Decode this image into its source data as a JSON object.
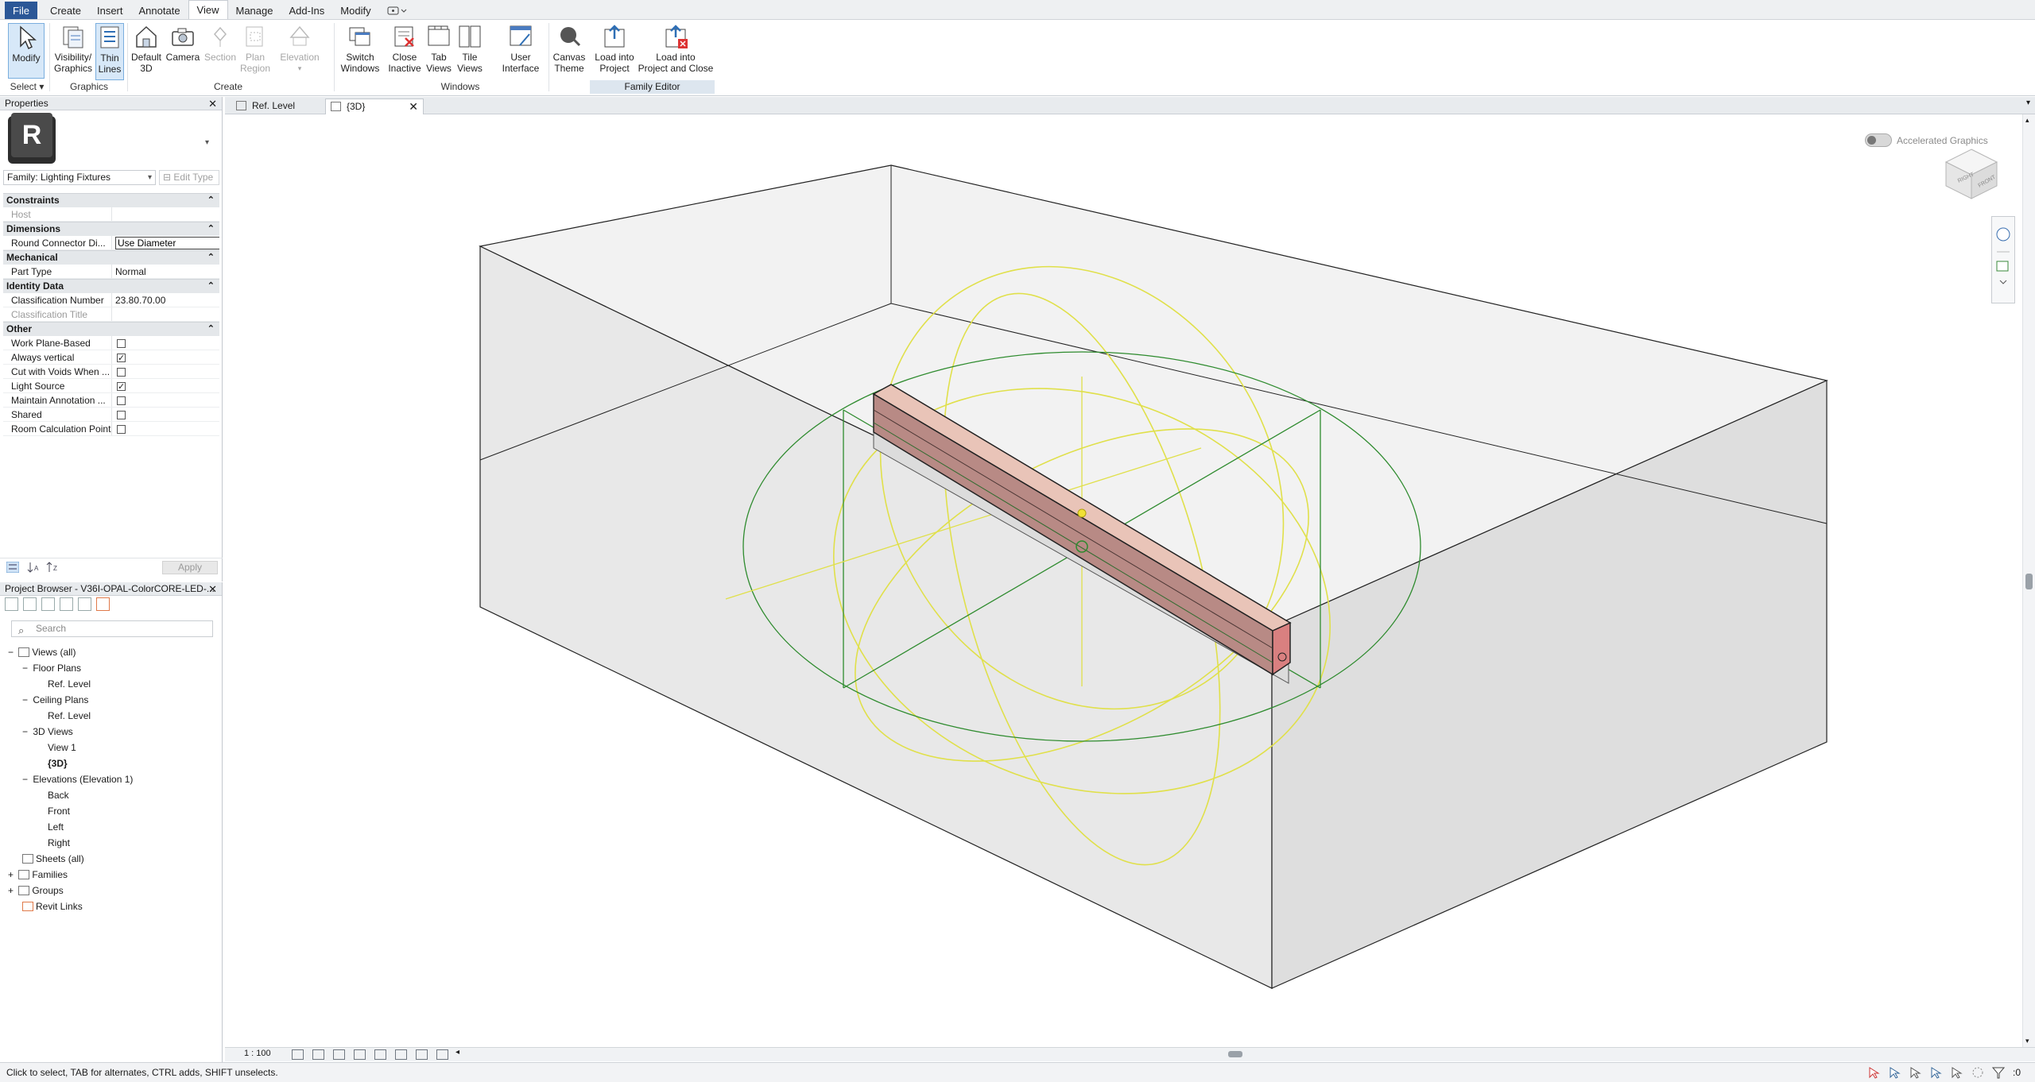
{
  "ribbon_tabs": [
    "File",
    "Create",
    "Insert",
    "Annotate",
    "View",
    "Manage",
    "Add-Ins",
    "Modify"
  ],
  "active_tab": "View",
  "ribbon": {
    "modify": "Modify",
    "select": "Select",
    "visibility_1": "Visibility/",
    "visibility_2": "Graphics",
    "thin_1": "Thin",
    "thin_2": "Lines",
    "graphics_group": "Graphics",
    "default3d_1": "Default",
    "default3d_2": "3D",
    "camera": "Camera",
    "section": "Section",
    "plan_region_1": "Plan",
    "plan_region_2": "Region",
    "elevation": "Elevation",
    "create_group": "Create",
    "switch_1": "Switch",
    "switch_2": "Windows",
    "close_1": "Close",
    "close_2": "Inactive",
    "tab_1": "Tab",
    "tab_2": "Views",
    "tile_1": "Tile",
    "tile_2": "Views",
    "ui_1": "User",
    "ui_2": "Interface",
    "windows_group": "Windows",
    "canvas_1": "Canvas",
    "canvas_2": "Theme",
    "load_1": "Load into",
    "load_2": "Project",
    "loadclose_1": "Load into",
    "loadclose_2": "Project and Close",
    "family_editor_group": "Family Editor"
  },
  "properties": {
    "title": "Properties",
    "family_selector": "Family: Lighting Fixtures",
    "edit_type": "Edit Type",
    "apply": "Apply",
    "sections": {
      "constraints": "Constraints",
      "dimensions": "Dimensions",
      "mechanical": "Mechanical",
      "identity": "Identity Data",
      "other": "Other"
    },
    "host": "Host",
    "round_connector": "Round Connector Di...",
    "round_connector_value": "Use Diameter",
    "part_type": "Part Type",
    "part_type_value": "Normal",
    "class_number": "Classification Number",
    "class_number_value": "23.80.70.00",
    "class_title": "Classification Title",
    "work_plane": "Work Plane-Based",
    "always_vertical": "Always vertical",
    "cut_voids": "Cut with Voids When ...",
    "light_source": "Light Source",
    "maintain_annotation": "Maintain Annotation ...",
    "shared": "Shared",
    "room_calc": "Room Calculation Point",
    "checks": {
      "work_plane": false,
      "always_vertical": true,
      "cut_voids": false,
      "light_source": true,
      "maintain_annotation": false,
      "shared": false,
      "room_calc": false
    }
  },
  "browser": {
    "title": "Project Browser - V36I-OPAL-ColorCORE-LED-...",
    "search_placeholder": "Search",
    "views_all": "Views (all)",
    "floor_plans": "Floor Plans",
    "fp_ref": "Ref. Level",
    "ceiling_plans": "Ceiling Plans",
    "cp_ref": "Ref. Level",
    "views_3d": "3D Views",
    "view1": "View 1",
    "view3d": "{3D}",
    "elevations": "Elevations (Elevation 1)",
    "back": "Back",
    "front": "Front",
    "left": "Left",
    "right": "Right",
    "sheets": "Sheets (all)",
    "families": "Families",
    "groups": "Groups",
    "revit_links": "Revit Links"
  },
  "view_tabs": {
    "tab1": "Ref. Level",
    "tab2": "{3D}"
  },
  "canvas": {
    "accelerated": "Accelerated Graphics",
    "viewcube_face_1": "RIGHT",
    "viewcube_face_2": "FRONT",
    "scale": "1 : 100"
  },
  "status": {
    "text": "Click to select, TAB for alternates, CTRL adds, SHIFT unselects.",
    "filter_count": ":0"
  },
  "colors": {
    "file_tab": "#2b5797",
    "selection_yellow": "#e0e04a",
    "ref_green": "#2e8b2e",
    "fixture_top": "#e9c4b8",
    "fixture_side": "#b88a85"
  }
}
